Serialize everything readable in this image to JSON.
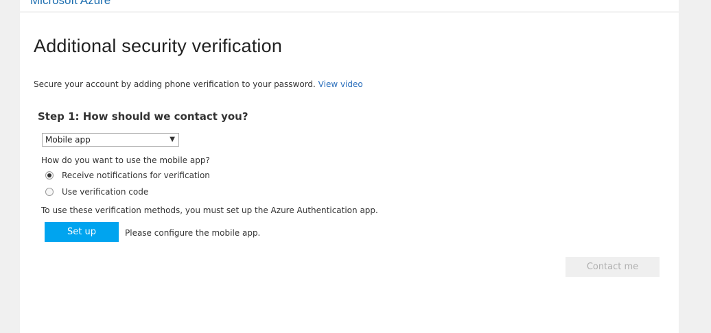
{
  "header": {
    "brand": "Microsoft Azure"
  },
  "main": {
    "title": "Additional security verification",
    "intro_text": "Secure your account by adding phone verification to your password. ",
    "view_video_link": "View video",
    "step_heading": "Step 1: How should we contact you?",
    "contact_method": {
      "selected": "Mobile app",
      "arrow": "▼"
    },
    "mobile_app_question": "How do you want to use the mobile app?",
    "options": [
      {
        "label": "Receive notifications for verification",
        "checked": true
      },
      {
        "label": "Use verification code",
        "checked": false
      }
    ],
    "setup_note": "To use these verification methods, you must set up the Azure Authentication app.",
    "setup_button": "Set up",
    "configure_message": "Please configure the mobile app.",
    "contact_button": "Contact me"
  },
  "colors": {
    "accent": "#00a4ef",
    "link": "#2a6ebb",
    "brand": "#1e6fb0",
    "disabled_button_bg": "#efefef"
  }
}
